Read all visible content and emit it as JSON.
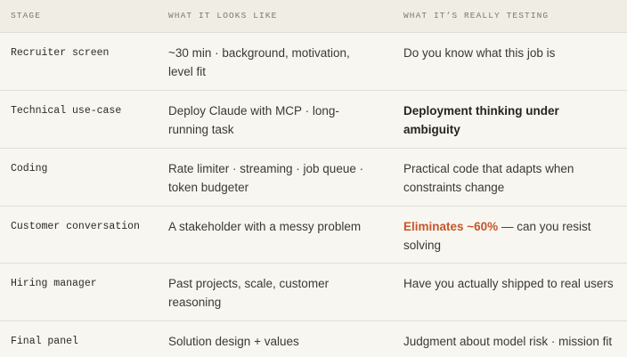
{
  "headers": {
    "stage": "STAGE",
    "looks": "WHAT IT LOOKS LIKE",
    "testing": "WHAT IT’S REALLY TESTING"
  },
  "colors": {
    "accent": "#c5562b",
    "header_bg": "#f0ede5",
    "body_bg": "#f8f6f1"
  },
  "rows": [
    {
      "stage": "Recruiter screen",
      "looks": "~30 min · background, motivation, level fit",
      "testing": "Do you know what this job is"
    },
    {
      "stage": "Technical use-case",
      "looks": "Deploy Claude with MCP · long-running task",
      "testing": "Deployment thinking under ambiguity"
    },
    {
      "stage": "Coding",
      "looks": "Rate limiter · streaming · job queue · token budgeter",
      "testing": "Practical code that adapts when constraints change"
    },
    {
      "stage": "Customer conversation",
      "looks": "A stakeholder with a messy problem",
      "testing_highlight": "Eliminates ~60%",
      "testing_rest": " — can you resist solving"
    },
    {
      "stage": "Hiring manager",
      "looks": "Past projects, scale, customer reasoning",
      "testing": "Have you actually shipped to real users"
    },
    {
      "stage": "Final panel",
      "looks": "Solution design + values",
      "testing": "Judgment about model risk · mission fit"
    }
  ]
}
